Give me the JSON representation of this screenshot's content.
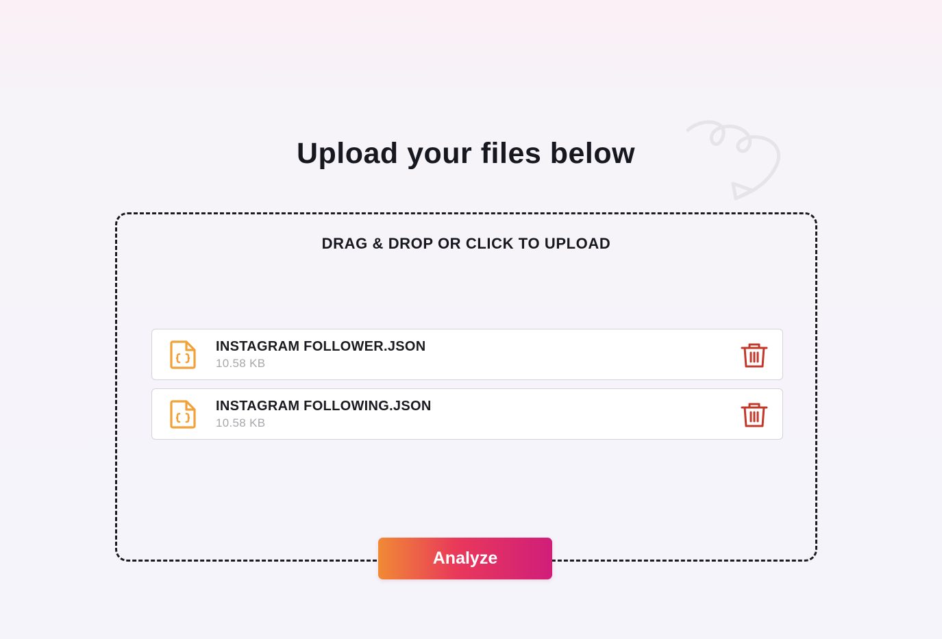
{
  "heading": "Upload your files below",
  "dropzone": {
    "label": "DRAG & DROP OR CLICK TO UPLOAD"
  },
  "files": [
    {
      "name": "INSTAGRAM FOLLOWER.JSON",
      "size": "10.58 KB",
      "icon": "json-file-icon",
      "delete_icon": "trash-icon"
    },
    {
      "name": "INSTAGRAM FOLLOWING.JSON",
      "size": "10.58 KB",
      "icon": "json-file-icon",
      "delete_icon": "trash-icon"
    }
  ],
  "analyze_button": {
    "label": "Analyze"
  },
  "colors": {
    "file_icon": "#f0a23a",
    "delete_icon": "#c0392b",
    "button_gradient_start": "#f08a35",
    "button_gradient_end": "#d01e7a"
  }
}
